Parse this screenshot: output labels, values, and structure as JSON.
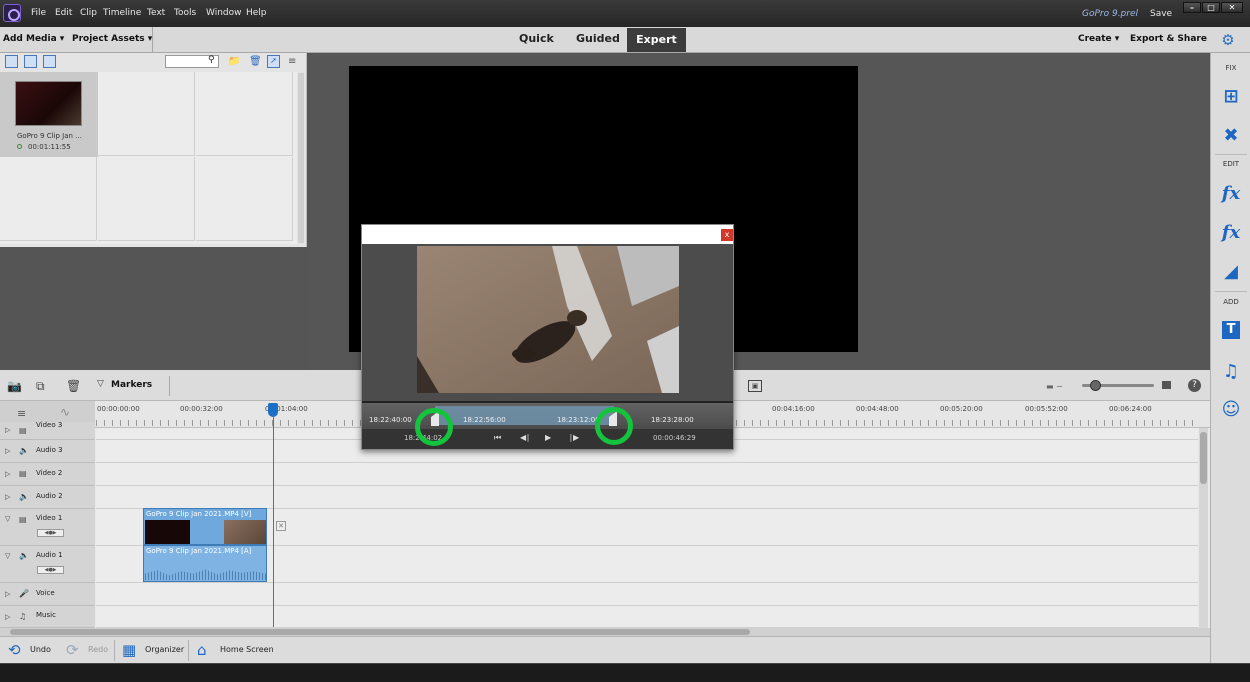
{
  "menubar": {
    "items": [
      "File",
      "Edit",
      "Clip",
      "Timeline",
      "Text",
      "Tools",
      "Window",
      "Help"
    ],
    "project_name": "GoPro 9.prel",
    "save": "Save"
  },
  "toolbar": {
    "add_media": "Add Media",
    "project_assets": "Project Assets",
    "modes": [
      "Quick",
      "Guided",
      "Expert"
    ],
    "active_mode": "Expert",
    "create": "Create",
    "export_share": "Export & Share"
  },
  "assets": {
    "clip_name": "GoPro 9 Clip Jan ...",
    "clip_duration": "00:01:11:55"
  },
  "right_panel": {
    "sections": [
      "FIX",
      "EDIT",
      "ADD"
    ]
  },
  "timeline": {
    "markers": "Markers",
    "ruler": [
      "00:00:00:00",
      "00:00:32:00",
      "00:01:04:00",
      "00:04:16:00",
      "00:04:48:00",
      "00:05:20:00",
      "00:05:52:00",
      "00:06:24:00"
    ],
    "tracks": [
      {
        "label": "Video 3"
      },
      {
        "label": "Audio 3"
      },
      {
        "label": "Video 2"
      },
      {
        "label": "Audio 2"
      },
      {
        "label": "Video 1"
      },
      {
        "label": "Audio 1"
      },
      {
        "label": "Voice"
      },
      {
        "label": "Music"
      }
    ],
    "clip_video_label": "GoPro 9 Clip Jan 2021.MP4 [V]",
    "clip_audio_label": "GoPro 9 Clip Jan 2021.MP4 [A]"
  },
  "dialog": {
    "close": "x",
    "strip_times": [
      "18:22:40:00",
      "18:22:56:00",
      "18:23:12:00",
      "18:23:28:00"
    ],
    "current_time": "18:2  44:02",
    "duration": "00:00:46:29"
  },
  "bottombar": {
    "undo": "Undo",
    "redo": "Redo",
    "organizer": "Organizer",
    "home_screen": "Home Screen"
  },
  "colors": {
    "accent_blue": "#1d67c2",
    "highlight_green": "#14c43d",
    "playhead_red": "#e53a3a"
  }
}
